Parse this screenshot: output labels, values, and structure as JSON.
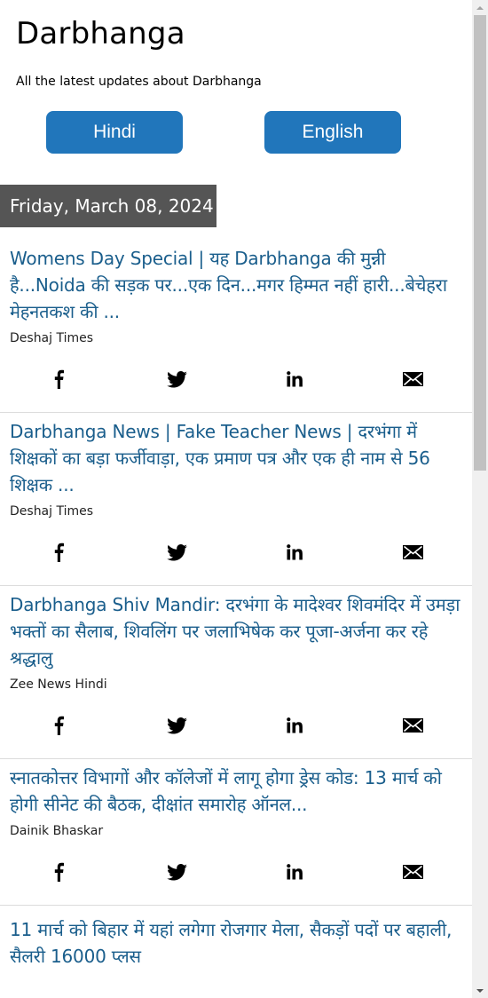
{
  "header": {
    "title": "Darbhanga",
    "description": "All the latest updates about Darbhanga"
  },
  "language_buttons": [
    {
      "label": "Hindi"
    },
    {
      "label": "English"
    }
  ],
  "date_header": "Friday, March 08, 2024",
  "colors": {
    "button_bg": "#2176bb",
    "date_banner_bg": "#555555",
    "headline": "#1a5e8c"
  },
  "share_icons": [
    "facebook-icon",
    "twitter-icon",
    "linkedin-icon",
    "email-icon"
  ],
  "articles": [
    {
      "title": "Womens Day Special | यह Darbhanga की मुन्नी है...Noida की सड़क पर...एक दिन...मगर हिम्मत नहीं हारी...बेचेहरा मेहनतकश की ...",
      "source": "Deshaj Times"
    },
    {
      "title": "Darbhanga News | Fake Teacher News | दरभंगा में शिक्षकों का बड़ा फर्जीवाड़ा, एक प्रमाण पत्र और एक ही नाम से 56 शिक्षक ...",
      "source": "Deshaj Times"
    },
    {
      "title": "Darbhanga Shiv Mandir: दरभंगा के मादेश्वर शिवमंदिर में उमड़ा भक्तों का सैलाब, शिवलिंग पर जलाभिषेक कर पूजा-अर्जना कर रहे श्रद्धालु",
      "source": "Zee News Hindi"
    },
    {
      "title": "स्नातकोत्तर विभागों और कॉलेजों में लागू होगा ड्रेस कोड: 13 मार्च को होगी सीनेट की बैठक, दीक्षांत समारोह ऑनल...",
      "source": "Dainik Bhaskar"
    },
    {
      "title": "11 मार्च को बिहार में यहां लगेगा रोजगार मेला, सैकड़ों पदों पर बहाली, सैलरी 16000 प्लस",
      "source": ""
    }
  ]
}
